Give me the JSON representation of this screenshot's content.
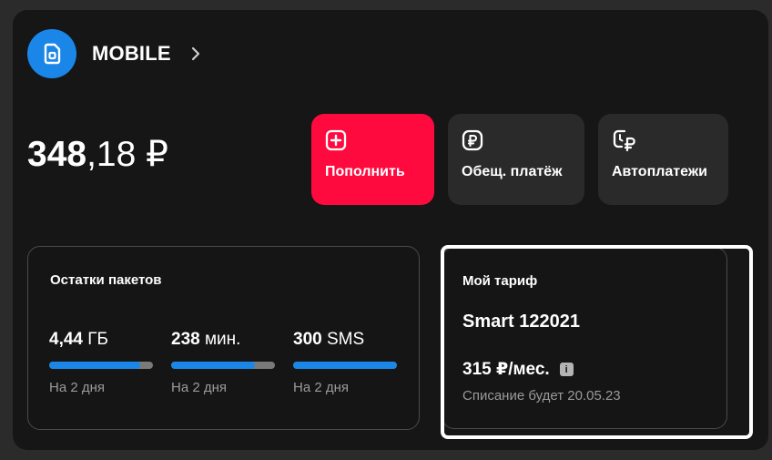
{
  "account": {
    "title": "MOBILE",
    "icon": "sim-card-icon",
    "chevron_icon": "chevron-right-icon"
  },
  "balance": {
    "integer": "348",
    "fraction": ",18 ₽"
  },
  "actions": [
    {
      "label": "Пополнить",
      "icon": "plus-icon"
    },
    {
      "label": "Обещ. платёж",
      "icon": "ruble-coin-icon"
    },
    {
      "label": "Автоплатежи",
      "icon": "autopay-ruble-icon"
    }
  ],
  "packets": {
    "title": "Остатки пакетов",
    "items": [
      {
        "value": "4,44",
        "unit": " ГБ",
        "sub": "На 2 дня",
        "fill_fraction": 0.88
      },
      {
        "value": "238",
        "unit": " мин.",
        "sub": "На 2 дня",
        "fill_fraction": 0.81
      },
      {
        "value": "300",
        "unit": " SMS",
        "sub": "На 2 дня",
        "fill_fraction": 1.0
      }
    ]
  },
  "tariff": {
    "title": "Мой тариф",
    "name": "Smart 122021",
    "price": "315 ₽/мес.",
    "info_glyph": "i",
    "note": "Списание будет 20.05.23"
  },
  "colors": {
    "accent": "#1a86e8",
    "primary_button": "#ff0a3f",
    "background": "#161616",
    "card": "#2a2a2a"
  }
}
